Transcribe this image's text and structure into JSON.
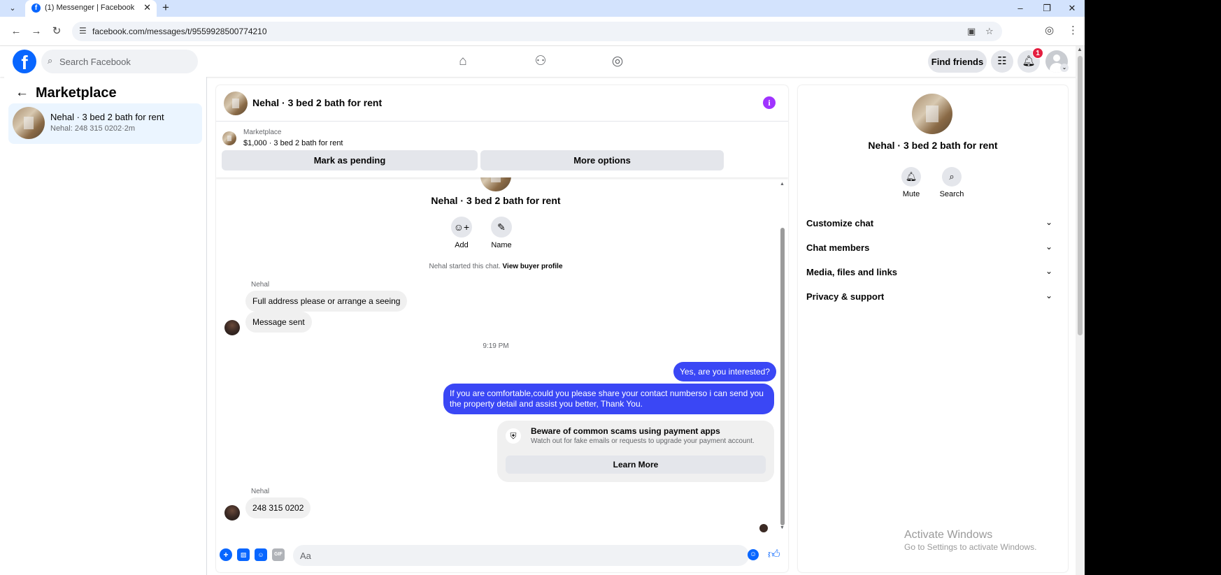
{
  "browser": {
    "tab_title": "(1) Messenger | Facebook",
    "url": "facebook.com/messages/t/9559928500774210"
  },
  "header": {
    "search_placeholder": "Search Facebook",
    "find_friends_label": "Find friends",
    "notification_count": "1"
  },
  "left_panel": {
    "title": "Marketplace",
    "conversation": {
      "name": "Nehal · 3 bed 2 bath for rent",
      "preview": "Nehal: 248 315 0202·2m"
    }
  },
  "chat": {
    "title": "Nehal · 3 bed 2 bath for rent",
    "marketplace_label": "Marketplace",
    "listing": "$1,000 · 3 bed 2 bath for rent",
    "mark_pending_label": "Mark as pending",
    "more_options_label": "More options",
    "thread_title": "Nehal · 3 bed 2 bath for rent",
    "add_label": "Add",
    "name_label": "Name",
    "started_text": "Nehal started this chat.",
    "view_buyer_label": "View buyer profile",
    "sender_name": "Nehal",
    "msg_1": "Full address please or arrange a seeing",
    "msg_2": "Message sent",
    "timestamp": "9:19 PM",
    "msg_out_1": "Yes, are you interested?",
    "msg_out_2": "If you are comfortable,could you please share your contact numberso i can send you the property detail and assist you better, Thank You.",
    "scam_title": "Beware of common scams using payment apps",
    "scam_sub": "Watch out for fake emails or requests to upgrade your payment account.",
    "learn_more_label": "Learn More",
    "sender_name_2": "Nehal",
    "msg_3": "248 315 0202",
    "composer_placeholder": "Aa"
  },
  "right_panel": {
    "name": "Nehal · 3 bed 2 bath for rent",
    "mute_label": "Mute",
    "search_label": "Search",
    "sections": [
      "Customize chat",
      "Chat members",
      "Media, files and links",
      "Privacy & support"
    ]
  },
  "watermark": {
    "line1": "Activate Windows",
    "line2": "Go to Settings to activate Windows."
  },
  "colors": {
    "accent": "#0866ff",
    "outgoing_bubble": "#3a47f5",
    "info": "#a033ff",
    "badge": "#e41e3f"
  }
}
